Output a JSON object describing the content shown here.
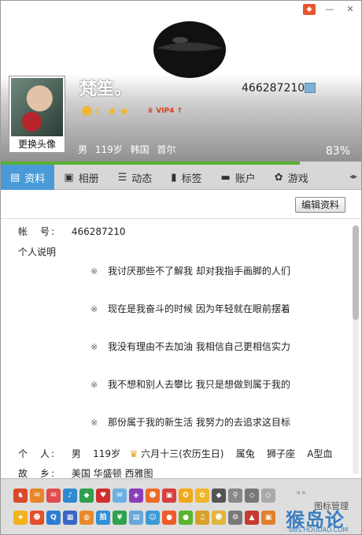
{
  "header": {
    "nickname": "梵笙。",
    "qq_number": "466287210",
    "change_avatar_label": "更换头像",
    "gender": "男",
    "age": "119岁",
    "location": "韩国 首尔",
    "completion": "83%",
    "completion_value": 0.83,
    "vip_label": "VIP4"
  },
  "tabs": [
    {
      "label": "资料",
      "icon": "profile-card-icon"
    },
    {
      "label": "相册",
      "icon": "photo-album-icon"
    },
    {
      "label": "动态",
      "icon": "feed-list-icon"
    },
    {
      "label": "标签",
      "icon": "bookmark-tag-icon"
    },
    {
      "label": "账户",
      "icon": "account-icon"
    },
    {
      "label": "游戏",
      "icon": "game-icon"
    }
  ],
  "content": {
    "edit_button": "编辑资料",
    "account_label": "帐　号:",
    "account_value": "466287210",
    "bio_label": "个人说明",
    "signature_lines": [
      "我讨厌那些不了解我 却对我指手画脚的人们",
      "现在是我奋斗的时候 因为年轻就在眼前摆着",
      "我没有理由不去加油 我相信自己更相信实力",
      "我不想和别人去攀比 我只是想做到属于我的",
      "那份属于我的新生活 我努力的去追求这目标"
    ],
    "signature_bullet": "※",
    "personal_label": "个　人:",
    "personal": {
      "gender": "男",
      "age": "119岁",
      "birthday": "六月十三(农历生日)",
      "zodiac": "属兔",
      "star_sign": "狮子座",
      "blood": "A型血"
    },
    "hometown_label": "故　乡:",
    "hometown_value": "美国 华盛顿 西雅图"
  },
  "iconbar": {
    "manage_label": "图标管理",
    "watermark": "猴岛论坛",
    "watermark_sub": "BBS.HOUDAO.COM"
  },
  "colors": {
    "tab_active": "#4a9ad8",
    "progress": "#58b031"
  }
}
